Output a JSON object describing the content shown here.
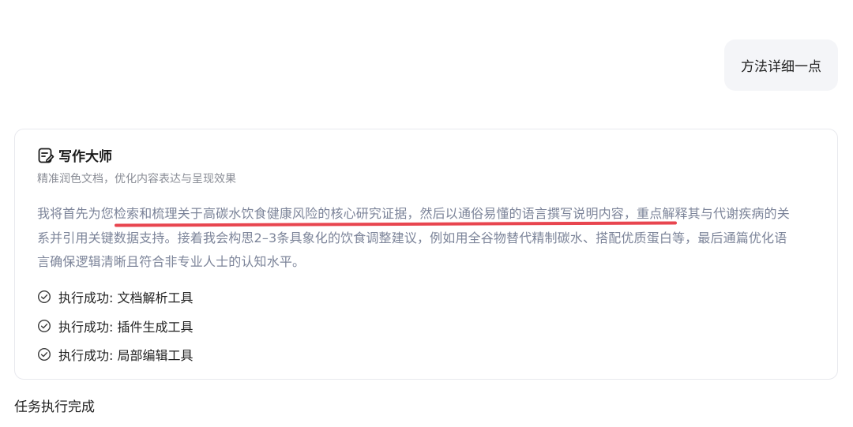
{
  "user_message": "方法详细一点",
  "card": {
    "title": "写作大师",
    "subtitle": "精准润色文档，优化内容表达与呈现效果",
    "description_lines": [
      "我将首先为您检索和梳理关于高碳水饮食健康风险的核心研究证据，然后以通俗易懂的语言撰写说明内容，重点解释其与代谢疾病的关",
      "系并引用关键数据支持。接着我会构思2–3条具象化的饮食调整建议，例如用全谷物替代精制碳水、搭配优质蛋白等，最后通篇优化语",
      "言确保逻辑清晰且符合非专业人士的认知水平。"
    ],
    "steps": [
      {
        "label": "执行成功: 文档解析工具"
      },
      {
        "label": "执行成功: 插件生成工具"
      },
      {
        "label": "执行成功: 局部编辑工具"
      }
    ],
    "colors": {
      "underline": "#e8454f",
      "description_text": "#7c8499",
      "border": "#e8e9ee"
    }
  },
  "status_text": "任务执行完成"
}
